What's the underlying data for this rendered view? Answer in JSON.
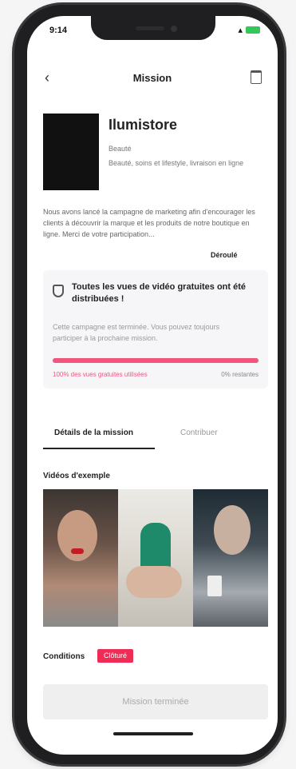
{
  "status": {
    "time": "9:14"
  },
  "nav": {
    "title": "Mission"
  },
  "brand": {
    "logo_text": "",
    "name": "Ilumistore",
    "lines": [
      "Beauté",
      "Beauté, soins et lifestyle, livraison en ligne"
    ]
  },
  "description": {
    "text": "Nous avons lancé la campagne de marketing afin d'encourager les clients à découvrir la marque et les produits de notre boutique en ligne. Merci de votre participation...",
    "more": "Déroulé"
  },
  "campaign": {
    "title": "Toutes les vues de vidéo gratuites ont été distribuées !",
    "text": "Cette campagne est terminée. Vous pouvez toujours participer à la prochaine mission.",
    "progress_left": "100% des vues gratuites utilisées",
    "progress_right": "0% restantes",
    "progress_fraction": 1.0
  },
  "tabs": [
    {
      "label": "Détails de la mission"
    },
    {
      "label": "Contribuer"
    }
  ],
  "section": {
    "title": "Vidéos d'exemple"
  },
  "conditions": {
    "label": "Conditions",
    "badge": "Clôturé"
  },
  "cta": {
    "label": "Mission terminée"
  },
  "colors": {
    "accent": "#ee2c55",
    "progress": "#f0567e"
  }
}
